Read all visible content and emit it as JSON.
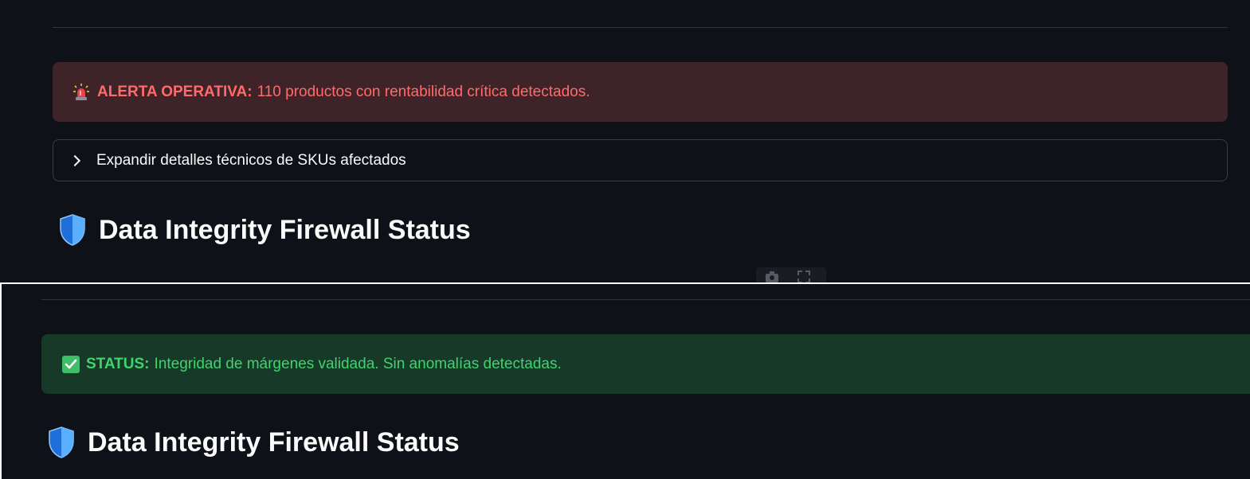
{
  "top_panel": {
    "error_alert": {
      "icon": "siren-icon",
      "label": "ALERTA OPERATIVA:",
      "message": "110 productos con rentabilidad crítica detectados."
    },
    "expander": {
      "label": "Expandir detalles técnicos de SKUs afectados"
    },
    "heading": {
      "icon": "shield-icon",
      "text": "Data Integrity Firewall Status"
    }
  },
  "bottom_panel": {
    "success_alert": {
      "icon": "check-icon",
      "label": "STATUS:",
      "message": "Integridad de márgenes validada. Sin anomalías detectadas."
    },
    "heading": {
      "icon": "shield-icon",
      "text": "Data Integrity Firewall Status"
    }
  },
  "colors": {
    "background": "#0e1117",
    "error_bg": "#3e2428",
    "error_text": "#ff6b6b",
    "success_bg": "#173928",
    "success_text": "#3dd56d"
  }
}
